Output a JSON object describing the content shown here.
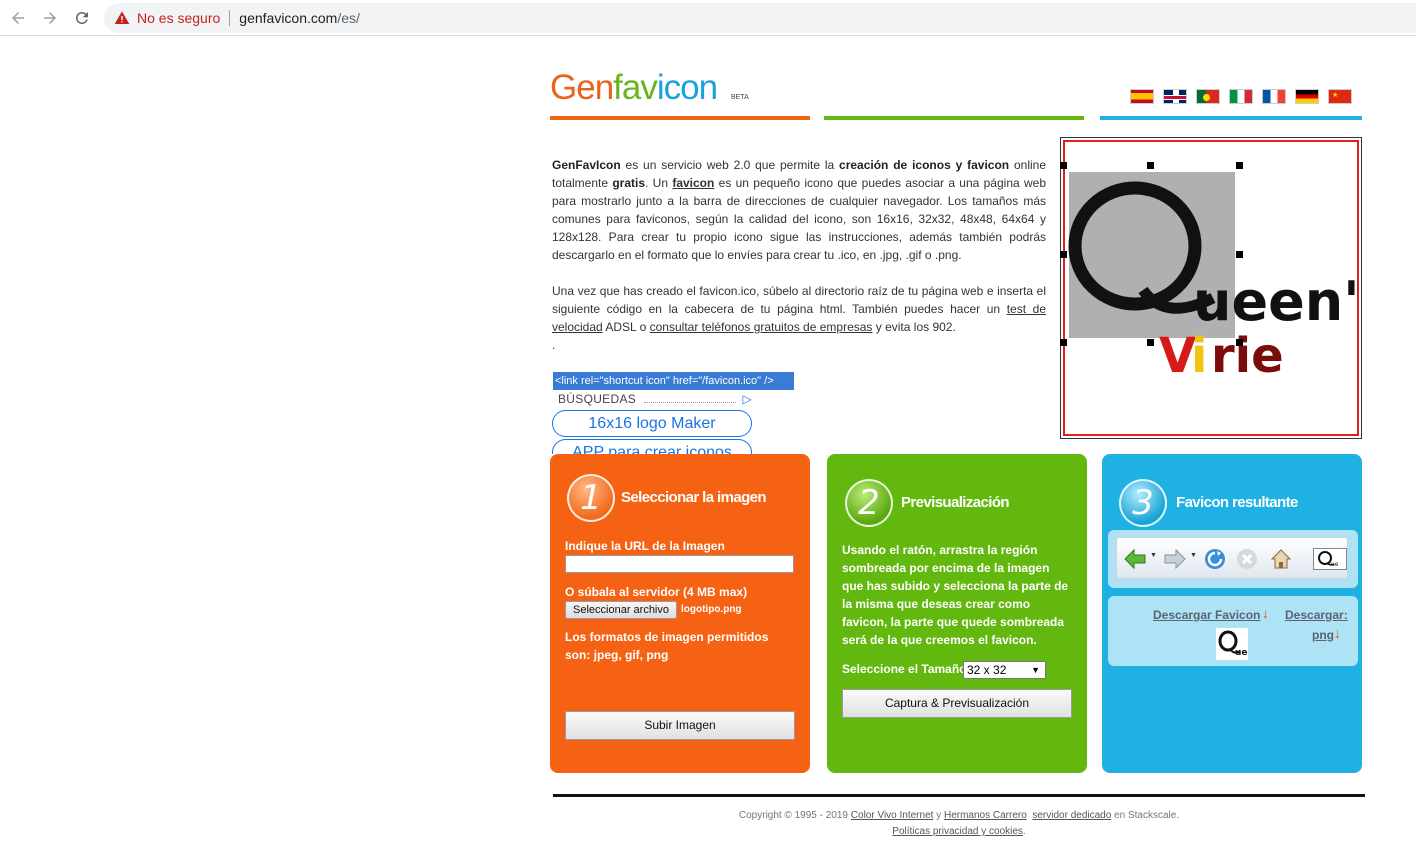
{
  "browser": {
    "security_label": "No es seguro",
    "url_host": "genfavicon.com",
    "url_path": "/es/"
  },
  "site": {
    "logo_part1": "Gen",
    "logo_part2": "fav",
    "logo_part3": "icon",
    "beta": "BETA",
    "flags": [
      "es",
      "gb",
      "pt",
      "it",
      "fr",
      "de",
      "cn"
    ],
    "colors": {
      "orange": "#f56213",
      "green": "#63b80f",
      "blue": "#1fb1e4"
    }
  },
  "intro": {
    "p1_brand": "GenFavIcon",
    "p1_a": " es un servicio web 2.0 que permite la ",
    "p1_bold1": "creación de iconos y favicon",
    "p1_b": " online totalmente ",
    "p1_bold2": "gratis",
    "p1_c": ". Un ",
    "p1_link": "favicon",
    "p1_d": " es un pequeño icono que puedes asociar a una página web para mostrarlo junto a la barra de direcciones de cualquier navegador. Los tamaños más comunes para faviconos, según la calidad del icono, son 16x16, 32x32, 48x48, 64x64 y 128x128. Para crear tu propio icono sigue las instrucciones, además también podrás descargarlo en el formato que lo envíes para crear tu .ico, en .jpg, .gif o .png.",
    "p2_a": "Una vez que has creado el favicon.ico, súbelo al directorio raíz de tu página web e inserta el siguiente código en la cabecera de tu página html. También puedes hacer un ",
    "p2_link1": "test de velocidad",
    "p2_b": " ADSL o ",
    "p2_link2": "consultar teléfonos gratuitos de empresas",
    "p2_c": " y evita los 902.",
    "dot": ".",
    "code": "<link rel=\"shortcut icon\" href=\"/favicon.ico\" />"
  },
  "ads": {
    "heading": "BÚSQUEDAS",
    "items": [
      "16x16 logo Maker",
      "APP para crear iconos"
    ]
  },
  "editor": {
    "logo_word": "ueen's",
    "logo_big_letter": "Q",
    "logo_sub": "Virie"
  },
  "step1": {
    "number": "1",
    "title": "Seleccionar la imagen",
    "url_label": "Indique la URL de la Imagen",
    "url_value": "",
    "upload_label": "O súbala al servidor (4 MB max)",
    "file_button": "Seleccionar archivo",
    "file_name": "logotipo.png",
    "formats_text": "Los formatos de imagen permitidos son: jpeg, gif, png",
    "submit": "Subir Imagen"
  },
  "step2": {
    "number": "2",
    "title": "Previsualización",
    "instructions": "Usando el ratón, arrastra la región sombreada por encima de la imagen que has subido y selecciona la parte de la misma que deseas crear como favicon, la parte que quede sombreada será de la que creemos el favicon.",
    "size_label": "Seleccione el Tamaño",
    "size_value": "32 x 32",
    "button": "Captura & Previsualización"
  },
  "step3": {
    "number": "3",
    "title": "Favicon resultante",
    "download_favicon": "Descargar Favicon",
    "download_png_1": "Descargar:",
    "download_png_2": "png"
  },
  "footer": {
    "line1_a": "Copyright © 1995 - 2019 ",
    "link1": "Color Vivo Internet",
    "line1_b": " y ",
    "link2": "Hermanos Carrero",
    "link3": "servidor dedicado",
    "line1_c": " en Stackscale.",
    "link4": "Políticas privacidad y cookies",
    "line2_end": "."
  }
}
